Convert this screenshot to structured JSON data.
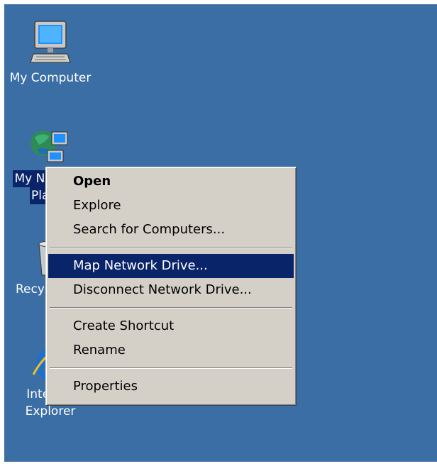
{
  "desktop": {
    "background_color": "#3a6ea5",
    "icons": [
      {
        "label": "My Computer",
        "icon": "computer-icon"
      },
      {
        "label_line1": "My Network",
        "label_line2": "Places",
        "icon": "network-places-icon",
        "selected": true
      },
      {
        "label": "Recycle Bin",
        "icon": "recycle-bin-icon"
      },
      {
        "label_line1": "Internet",
        "label_line2": "Explorer",
        "icon": "internet-explorer-icon"
      }
    ]
  },
  "context_menu": {
    "items": [
      {
        "label": "Open",
        "bold": true
      },
      {
        "label": "Explore"
      },
      {
        "label": "Search for Computers..."
      },
      {
        "label": "Map Network Drive...",
        "highlighted": true
      },
      {
        "label": "Disconnect Network Drive..."
      },
      {
        "label": "Create Shortcut"
      },
      {
        "label": "Rename"
      },
      {
        "label": "Properties"
      }
    ],
    "highlight_color": "#0a246a",
    "menu_color": "#d4d0c8"
  }
}
